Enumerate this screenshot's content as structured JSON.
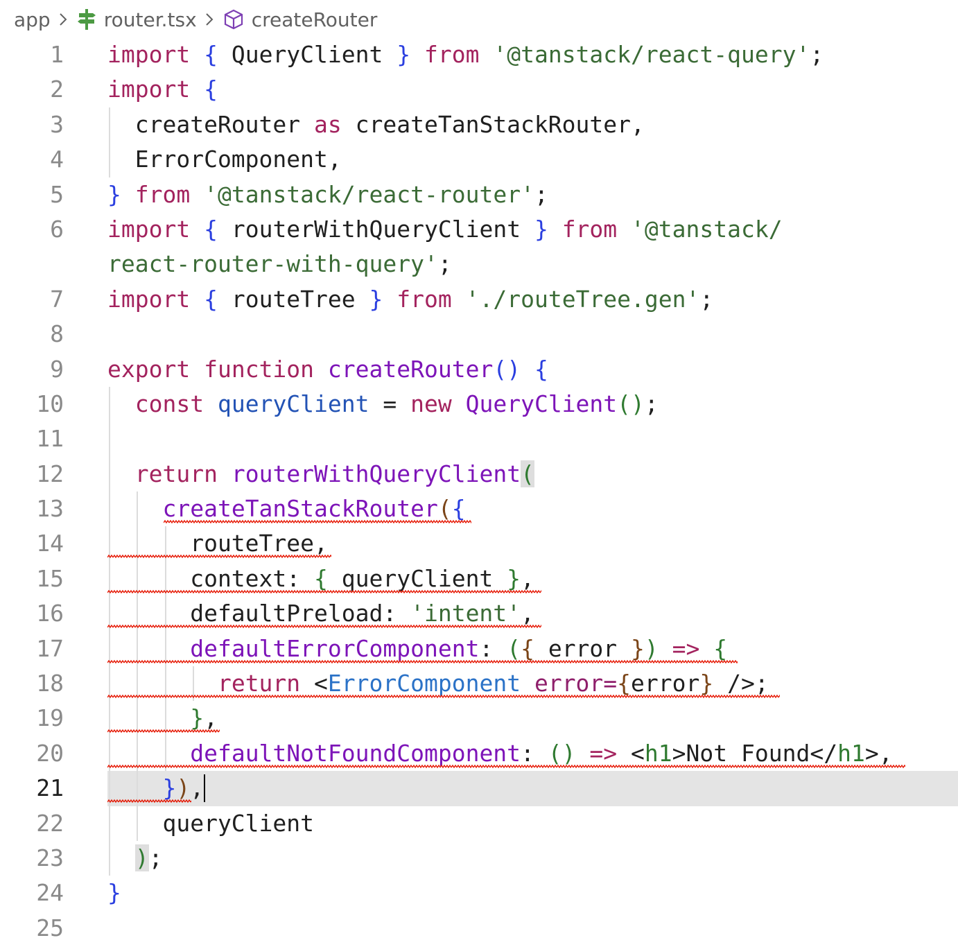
{
  "breadcrumb": {
    "folder": "app",
    "file": "router.tsx",
    "symbol": "createRouter",
    "file_icon": "tanstack-router-file-icon",
    "symbol_icon": "cube-method-icon",
    "separator_icon": "chevron-right-icon"
  },
  "editor": {
    "language": "typescript-react",
    "current_line": "21",
    "lines": [
      {
        "num": "1",
        "tokens": [
          [
            "kw",
            "import"
          ],
          [
            "plain",
            " "
          ],
          [
            "b1",
            "{"
          ],
          [
            "plain",
            " QueryClient "
          ],
          [
            "b1",
            "}"
          ],
          [
            "plain",
            " "
          ],
          [
            "kw",
            "from"
          ],
          [
            "plain",
            " "
          ],
          [
            "str",
            "'@tanstack/react-query'"
          ],
          [
            "plain",
            ";"
          ]
        ]
      },
      {
        "num": "2",
        "tokens": [
          [
            "kw",
            "import"
          ],
          [
            "plain",
            " "
          ],
          [
            "b1",
            "{"
          ]
        ]
      },
      {
        "num": "3",
        "tokens": [
          [
            "plain",
            "  createRouter "
          ],
          [
            "kw",
            "as"
          ],
          [
            "plain",
            " createTanStackRouter,"
          ]
        ]
      },
      {
        "num": "4",
        "tokens": [
          [
            "plain",
            "  ErrorComponent,"
          ]
        ]
      },
      {
        "num": "5",
        "tokens": [
          [
            "b1",
            "}"
          ],
          [
            "plain",
            " "
          ],
          [
            "kw",
            "from"
          ],
          [
            "plain",
            " "
          ],
          [
            "str",
            "'@tanstack/react-router'"
          ],
          [
            "plain",
            ";"
          ]
        ]
      },
      {
        "num": "6",
        "tokens": [
          [
            "kw",
            "import"
          ],
          [
            "plain",
            " "
          ],
          [
            "b1",
            "{"
          ],
          [
            "plain",
            " routerWithQueryClient "
          ],
          [
            "b1",
            "}"
          ],
          [
            "plain",
            " "
          ],
          [
            "kw",
            "from"
          ],
          [
            "plain",
            " "
          ],
          [
            "str",
            "'@tanstack/"
          ]
        ]
      },
      {
        "num": "",
        "tokens": [
          [
            "str",
            "react-router-with-query'"
          ],
          [
            "plain",
            ";"
          ]
        ]
      },
      {
        "num": "7",
        "tokens": [
          [
            "kw",
            "import"
          ],
          [
            "plain",
            " "
          ],
          [
            "b1",
            "{"
          ],
          [
            "plain",
            " routeTree "
          ],
          [
            "b1",
            "}"
          ],
          [
            "plain",
            " "
          ],
          [
            "kw",
            "from"
          ],
          [
            "plain",
            " "
          ],
          [
            "str",
            "'./routeTree.gen'"
          ],
          [
            "plain",
            ";"
          ]
        ]
      },
      {
        "num": "8",
        "tokens": []
      },
      {
        "num": "9",
        "tokens": [
          [
            "kw",
            "export"
          ],
          [
            "plain",
            " "
          ],
          [
            "kw",
            "function"
          ],
          [
            "plain",
            " "
          ],
          [
            "fn",
            "createRouter"
          ],
          [
            "b1",
            "()"
          ],
          [
            "plain",
            " "
          ],
          [
            "b1",
            "{"
          ]
        ]
      },
      {
        "num": "10",
        "tokens": [
          [
            "plain",
            "  "
          ],
          [
            "kw",
            "const"
          ],
          [
            "plain",
            " "
          ],
          [
            "var",
            "queryClient"
          ],
          [
            "plain",
            " = "
          ],
          [
            "kw",
            "new"
          ],
          [
            "plain",
            " "
          ],
          [
            "fn",
            "QueryClient"
          ],
          [
            "b2",
            "()"
          ],
          [
            "plain",
            ";"
          ]
        ]
      },
      {
        "num": "11",
        "tokens": []
      },
      {
        "num": "12",
        "tokens": [
          [
            "plain",
            "  "
          ],
          [
            "kw",
            "return"
          ],
          [
            "plain",
            " "
          ],
          [
            "fn",
            "routerWithQueryClient"
          ],
          [
            "b2hl",
            "("
          ]
        ]
      },
      {
        "num": "13",
        "tokens": [
          [
            "plain",
            "    "
          ],
          [
            "fn",
            "createTanStackRouter"
          ],
          [
            "b3",
            "("
          ],
          [
            "b1",
            "{"
          ]
        ]
      },
      {
        "num": "14",
        "tokens": [
          [
            "plain",
            "      routeTree,"
          ]
        ]
      },
      {
        "num": "15",
        "tokens": [
          [
            "plain",
            "      context: "
          ],
          [
            "b2",
            "{"
          ],
          [
            "plain",
            " queryClient "
          ],
          [
            "b2",
            "}"
          ],
          [
            "plain",
            ","
          ]
        ]
      },
      {
        "num": "16",
        "tokens": [
          [
            "plain",
            "      defaultPreload: "
          ],
          [
            "str",
            "'intent'"
          ],
          [
            "plain",
            ","
          ]
        ]
      },
      {
        "num": "17",
        "tokens": [
          [
            "plain",
            "      "
          ],
          [
            "fn",
            "defaultErrorComponent"
          ],
          [
            "plain",
            ": "
          ],
          [
            "b2",
            "("
          ],
          [
            "b3",
            "{"
          ],
          [
            "plain",
            " error "
          ],
          [
            "b3",
            "}"
          ],
          [
            "b2",
            ")"
          ],
          [
            "plain",
            " "
          ],
          [
            "kw",
            "=>"
          ],
          [
            "plain",
            " "
          ],
          [
            "b2",
            "{"
          ]
        ]
      },
      {
        "num": "18",
        "tokens": [
          [
            "plain",
            "        "
          ],
          [
            "kw",
            "return"
          ],
          [
            "plain",
            " <"
          ],
          [
            "tag",
            "ErrorComponent"
          ],
          [
            "plain",
            " "
          ],
          [
            "attr",
            "error="
          ],
          [
            "b3",
            "{"
          ],
          [
            "plain",
            "error"
          ],
          [
            "b3",
            "}"
          ],
          [
            "plain",
            " />;"
          ]
        ]
      },
      {
        "num": "19",
        "tokens": [
          [
            "plain",
            "      "
          ],
          [
            "b2",
            "}"
          ],
          [
            "plain",
            ","
          ]
        ]
      },
      {
        "num": "20",
        "tokens": [
          [
            "plain",
            "      "
          ],
          [
            "fn",
            "defaultNotFoundComponent"
          ],
          [
            "plain",
            ": "
          ],
          [
            "b2",
            "()"
          ],
          [
            "plain",
            " "
          ],
          [
            "kw",
            "=>"
          ],
          [
            "plain",
            " <"
          ],
          [
            "b2",
            "h1"
          ],
          [
            "plain",
            ">Not Found</"
          ],
          [
            "b2",
            "h1"
          ],
          [
            "plain",
            ">,"
          ]
        ]
      },
      {
        "num": "21",
        "tokens": [
          [
            "plain",
            "    "
          ],
          [
            "b1",
            "}"
          ],
          [
            "b3",
            ")"
          ],
          [
            "plain",
            ","
          ],
          [
            "cursor",
            ""
          ]
        ]
      },
      {
        "num": "22",
        "tokens": [
          [
            "plain",
            "    queryClient"
          ]
        ]
      },
      {
        "num": "23",
        "tokens": [
          [
            "plain",
            "  "
          ],
          [
            "b2hl",
            ")"
          ],
          [
            "plain",
            ";"
          ]
        ]
      },
      {
        "num": "24",
        "tokens": [
          [
            "b1",
            "}"
          ]
        ]
      },
      {
        "num": "25",
        "tokens": []
      }
    ]
  }
}
